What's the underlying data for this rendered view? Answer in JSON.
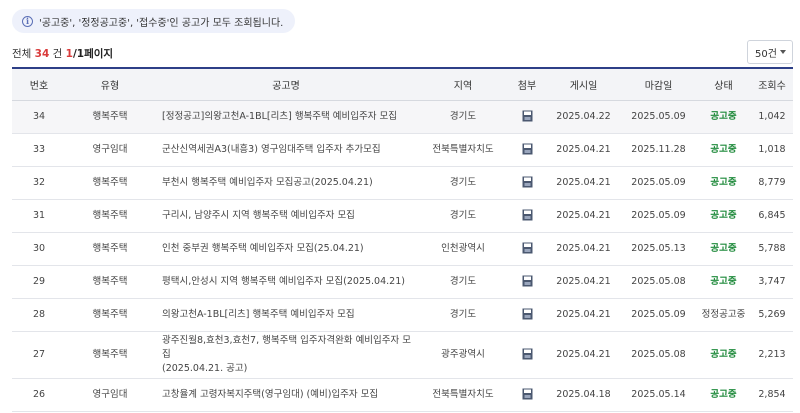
{
  "notice": {
    "icon": "info-icon",
    "text": "'공고중', '정정공고중', '접수중'인 공고가 모두 조회됩니다."
  },
  "summary": {
    "prefix": "전체",
    "total": "34",
    "unit": "건",
    "current_page": "1",
    "page_suffix": "/1페이지"
  },
  "page_size": {
    "selected": "50건"
  },
  "table": {
    "headers": [
      "번호",
      "유형",
      "공고명",
      "지역",
      "첨부",
      "게시일",
      "마감일",
      "상태",
      "조회수"
    ],
    "rows": [
      {
        "no": "34",
        "type": "행복주택",
        "title": "[정정공고]의왕고천A-1BL[리츠] 행복주택 예비입주자 모집",
        "region": "경기도",
        "attach": "file-icon",
        "posted": "2025.04.22",
        "deadline": "2025.05.09",
        "status": "공고중",
        "views": "1,042"
      },
      {
        "no": "33",
        "type": "영구임대",
        "title": "군산신역세권A3(내흥3) 영구임대주택 입주자 추가모집",
        "region": "전북특별자치도",
        "attach": "file-icon",
        "posted": "2025.04.21",
        "deadline": "2025.11.28",
        "status": "공고중",
        "views": "1,018"
      },
      {
        "no": "32",
        "type": "행복주택",
        "title": "부천시 행복주택 예비입주자 모집공고(2025.04.21)",
        "region": "경기도",
        "attach": "file-icon",
        "posted": "2025.04.21",
        "deadline": "2025.05.09",
        "status": "공고중",
        "views": "8,779"
      },
      {
        "no": "31",
        "type": "행복주택",
        "title": "구리시, 남양주시 지역 행복주택 예비입주자 모집",
        "region": "경기도",
        "attach": "file-icon",
        "posted": "2025.04.21",
        "deadline": "2025.05.09",
        "status": "공고중",
        "views": "6,845"
      },
      {
        "no": "30",
        "type": "행복주택",
        "title": "인천 중부권 행복주택 예비입주자 모집(25.04.21)",
        "region": "인천광역시",
        "attach": "file-icon",
        "posted": "2025.04.21",
        "deadline": "2025.05.13",
        "status": "공고중",
        "views": "5,788"
      },
      {
        "no": "29",
        "type": "행복주택",
        "title": "평택시,안성시 지역 행복주택 예비입주자 모집(2025.04.21)",
        "region": "경기도",
        "attach": "file-icon",
        "posted": "2025.04.21",
        "deadline": "2025.05.08",
        "status": "공고중",
        "views": "3,747"
      },
      {
        "no": "28",
        "type": "행복주택",
        "title": "의왕고천A-1BL[리츠] 행복주택 예비입주자 모집",
        "region": "경기도",
        "attach": "file-icon",
        "posted": "2025.04.21",
        "deadline": "2025.05.09",
        "status": "정정공고중",
        "views": "5,269"
      },
      {
        "no": "27",
        "type": "행복주택",
        "title_line1": "광주진월8,효천3,효천7, 행복주택 입주자격완화 예비입주자 모집",
        "title_line2": "(2025.04.21. 공고)",
        "region": "광주광역시",
        "attach": "file-icon",
        "posted": "2025.04.21",
        "deadline": "2025.05.08",
        "status": "공고중",
        "views": "2,213"
      },
      {
        "no": "26",
        "type": "영구임대",
        "title": "고창율계 고령자복지주택(영구임대) (예비)입주자 모집",
        "region": "전북특별자치도",
        "attach": "file-icon",
        "posted": "2025.04.18",
        "deadline": "2025.05.14",
        "status": "공고중",
        "views": "2,854"
      }
    ]
  },
  "colors": {
    "accent": "#2d3f87",
    "total_red": "#d93b3b",
    "status_open": "#1f8a3b",
    "notice_bg": "#eef1fb"
  }
}
